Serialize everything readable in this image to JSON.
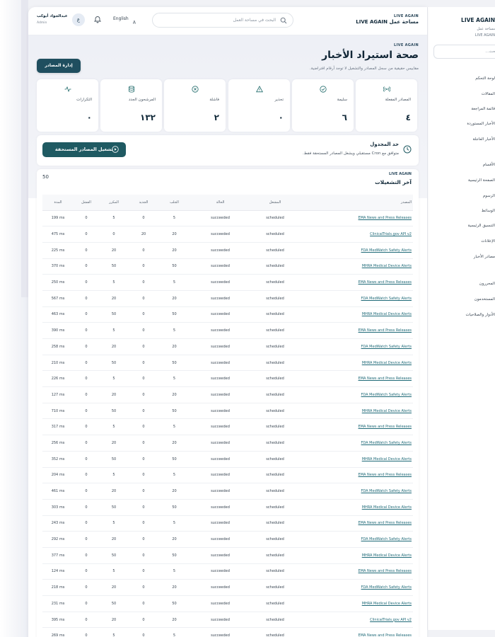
{
  "sidebar": {
    "brand": "LIVE AGAIN",
    "subtitle": "مساحة عمل",
    "subtitle2": "LIVE AGAIN",
    "search_placeholder": "بحث...",
    "items": [
      {
        "label": "لوحة التحكم"
      },
      {
        "label": "المقالات"
      },
      {
        "label": "قائمة المراجعة"
      },
      {
        "label": "الأخبار المستوردة"
      },
      {
        "label": "الأخبار العاجلة"
      },
      {
        "label": "الأقسام"
      },
      {
        "label": "الصفحة الرئيسية"
      },
      {
        "label": "الرسوم"
      },
      {
        "label": "الوسائط"
      },
      {
        "label": "التنسيق الرئيسية"
      },
      {
        "label": "الإعلانات"
      },
      {
        "label": "مصادر الأخبار"
      },
      {
        "label": "المحررون"
      },
      {
        "label": "المستخدمون"
      },
      {
        "label": "الأدوار والصلاحيات"
      }
    ]
  },
  "topbar": {
    "brand_small": "LIVE AGAIN",
    "brand": "مساحة عمل LIVE AGAIN",
    "search_placeholder": "البحث في مساحة العمل",
    "language": "English",
    "user_initial": "ع",
    "user_name": "عبدالجواد أبوكب",
    "user_role": "Admin"
  },
  "header": {
    "small": "LIVE AGAIN",
    "title": "صحة استيراد الأخبار",
    "subtitle": "مقاييس حقيقية من سجل المصادر والتشغيل لا توجد أرقام افتراضية.",
    "manage_button": "إدارة المصادر"
  },
  "stats": [
    {
      "icon": "signal-icon",
      "label": "المصادر المفعلة",
      "value": "٤"
    },
    {
      "icon": "check-circle-icon",
      "label": "سليمة",
      "value": "٦"
    },
    {
      "icon": "warning-icon",
      "label": "تحذير",
      "value": "٠"
    },
    {
      "icon": "x-circle-icon",
      "label": "فاشلة",
      "value": "٢"
    },
    {
      "icon": "database-icon",
      "label": "المرشحون الجدد",
      "value": "١٣٢"
    },
    {
      "icon": "activity-icon",
      "label": "التكرارات",
      "value": "٠"
    }
  ],
  "cron": {
    "title": "حد المجدول",
    "subtitle": "متوافق مع Cron مستقبلي ويشغل المصادر المستحقة فقط.",
    "run_button": "تشغيل المصادر المستحقة"
  },
  "runs": {
    "small": "LIVE AGAIN",
    "title": "آخر التشغيلات",
    "count": "50",
    "columns": [
      "المصدر",
      "المشغل",
      "الحالة",
      "الجلب",
      "الجديد",
      "المكرر",
      "الفشل",
      "المدة"
    ],
    "rows": [
      [
        "EMA News and Press Releases",
        "scheduled",
        "succeeded",
        "5",
        "0",
        "5",
        "0",
        "199 ms"
      ],
      [
        "ClinicalTrials.gov API v2",
        "scheduled",
        "succeeded",
        "20",
        "20",
        "0",
        "0",
        "475 ms"
      ],
      [
        "FDA MedWatch Safety Alerts",
        "scheduled",
        "succeeded",
        "20",
        "0",
        "20",
        "0",
        "225 ms"
      ],
      [
        "MHRA Medical Device Alerts",
        "scheduled",
        "succeeded",
        "50",
        "0",
        "50",
        "0",
        "370 ms"
      ],
      [
        "EMA News and Press Releases",
        "scheduled",
        "succeeded",
        "5",
        "0",
        "5",
        "0",
        "250 ms"
      ],
      [
        "FDA MedWatch Safety Alerts",
        "scheduled",
        "succeeded",
        "20",
        "0",
        "20",
        "0",
        "567 ms"
      ],
      [
        "MHRA Medical Device Alerts",
        "scheduled",
        "succeeded",
        "50",
        "0",
        "50",
        "0",
        "463 ms"
      ],
      [
        "EMA News and Press Releases",
        "scheduled",
        "succeeded",
        "5",
        "0",
        "5",
        "0",
        "390 ms"
      ],
      [
        "FDA MedWatch Safety Alerts",
        "scheduled",
        "succeeded",
        "20",
        "0",
        "20",
        "0",
        "258 ms"
      ],
      [
        "MHRA Medical Device Alerts",
        "scheduled",
        "succeeded",
        "50",
        "0",
        "50",
        "0",
        "210 ms"
      ],
      [
        "EMA News and Press Releases",
        "scheduled",
        "succeeded",
        "5",
        "0",
        "5",
        "0",
        "226 ms"
      ],
      [
        "FDA MedWatch Safety Alerts",
        "scheduled",
        "succeeded",
        "20",
        "0",
        "20",
        "0",
        "127 ms"
      ],
      [
        "MHRA Medical Device Alerts",
        "scheduled",
        "succeeded",
        "50",
        "0",
        "50",
        "0",
        "710 ms"
      ],
      [
        "EMA News and Press Releases",
        "scheduled",
        "succeeded",
        "5",
        "0",
        "5",
        "0",
        "317 ms"
      ],
      [
        "FDA MedWatch Safety Alerts",
        "scheduled",
        "succeeded",
        "20",
        "0",
        "20",
        "0",
        "256 ms"
      ],
      [
        "MHRA Medical Device Alerts",
        "scheduled",
        "succeeded",
        "50",
        "0",
        "50",
        "0",
        "352 ms"
      ],
      [
        "EMA News and Press Releases",
        "scheduled",
        "succeeded",
        "5",
        "0",
        "5",
        "0",
        "204 ms"
      ],
      [
        "FDA MedWatch Safety Alerts",
        "scheduled",
        "succeeded",
        "20",
        "0",
        "20",
        "0",
        "461 ms"
      ],
      [
        "MHRA Medical Device Alerts",
        "scheduled",
        "succeeded",
        "50",
        "0",
        "50",
        "0",
        "303 ms"
      ],
      [
        "EMA News and Press Releases",
        "scheduled",
        "succeeded",
        "5",
        "0",
        "5",
        "0",
        "243 ms"
      ],
      [
        "FDA MedWatch Safety Alerts",
        "scheduled",
        "succeeded",
        "20",
        "0",
        "20",
        "0",
        "292 ms"
      ],
      [
        "MHRA Medical Device Alerts",
        "scheduled",
        "succeeded",
        "50",
        "0",
        "50",
        "0",
        "377 ms"
      ],
      [
        "EMA News and Press Releases",
        "scheduled",
        "succeeded",
        "5",
        "0",
        "5",
        "0",
        "124 ms"
      ],
      [
        "FDA MedWatch Safety Alerts",
        "scheduled",
        "succeeded",
        "20",
        "0",
        "20",
        "0",
        "218 ms"
      ],
      [
        "MHRA Medical Device Alerts",
        "scheduled",
        "succeeded",
        "50",
        "0",
        "50",
        "0",
        "231 ms"
      ],
      [
        "ClinicalTrials.gov API v2",
        "scheduled",
        "succeeded",
        "20",
        "0",
        "20",
        "0",
        "395 ms"
      ],
      [
        "EMA News and Press Releases",
        "scheduled",
        "succeeded",
        "5",
        "0",
        "5",
        "0",
        "269 ms"
      ]
    ]
  }
}
